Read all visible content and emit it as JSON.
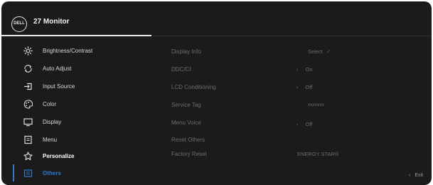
{
  "header": {
    "logo_text": "DELL",
    "title": "27 Monitor"
  },
  "sidebar": {
    "items": [
      {
        "label": "Brightness/Contrast",
        "icon": "brightness-icon"
      },
      {
        "label": "Auto Adjust",
        "icon": "auto-adjust-icon"
      },
      {
        "label": "Input Source",
        "icon": "input-source-icon"
      },
      {
        "label": "Color",
        "icon": "color-icon"
      },
      {
        "label": "Display",
        "icon": "display-icon"
      },
      {
        "label": "Menu",
        "icon": "menu-icon"
      },
      {
        "label": "Personalize",
        "icon": "star-icon"
      },
      {
        "label": "Others",
        "icon": "others-icon"
      }
    ]
  },
  "options": [
    {
      "label": "Display Info",
      "value": "Select",
      "value_icon": "check-icon"
    },
    {
      "label": "DDC/CI",
      "value": "On",
      "has_arrow": true
    },
    {
      "label": "LCD Conditioning",
      "value": "Off",
      "has_arrow": true
    },
    {
      "label": "Service Tag",
      "value": "xxxxxxx"
    },
    {
      "label": "Menu Voice",
      "value": "Off",
      "has_arrow": true
    },
    {
      "label": "Reset Others",
      "value": ""
    },
    {
      "label": "Factory Reset",
      "value": "ENERGY STAR®"
    }
  ],
  "footer": {
    "exit_label": "Exit"
  },
  "colors": {
    "background": "#1b1b1b",
    "accent": "#2b7bd0",
    "text": "#d8d8d8",
    "dim_text": "#6c6c6c"
  }
}
